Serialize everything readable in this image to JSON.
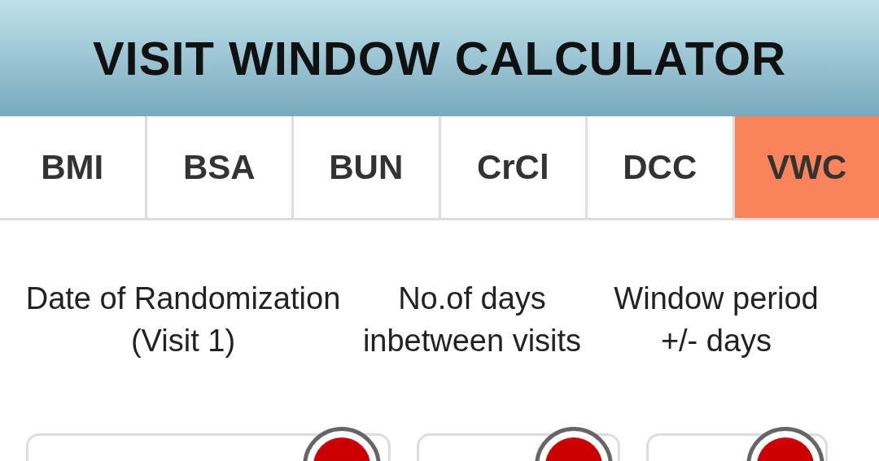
{
  "header": {
    "title": "VISIT WINDOW CALCULATOR"
  },
  "tabs": [
    {
      "label": "BMI",
      "selected": false
    },
    {
      "label": "BSA",
      "selected": false
    },
    {
      "label": "BUN",
      "selected": false
    },
    {
      "label": "CrCl",
      "selected": false
    },
    {
      "label": "DCC",
      "selected": false
    },
    {
      "label": "VWC",
      "selected": true
    }
  ],
  "fields": [
    {
      "label": "Date of Randomization (Visit 1)"
    },
    {
      "label": "No.of days inbetween visits"
    },
    {
      "label": "Window period +/- days"
    }
  ]
}
